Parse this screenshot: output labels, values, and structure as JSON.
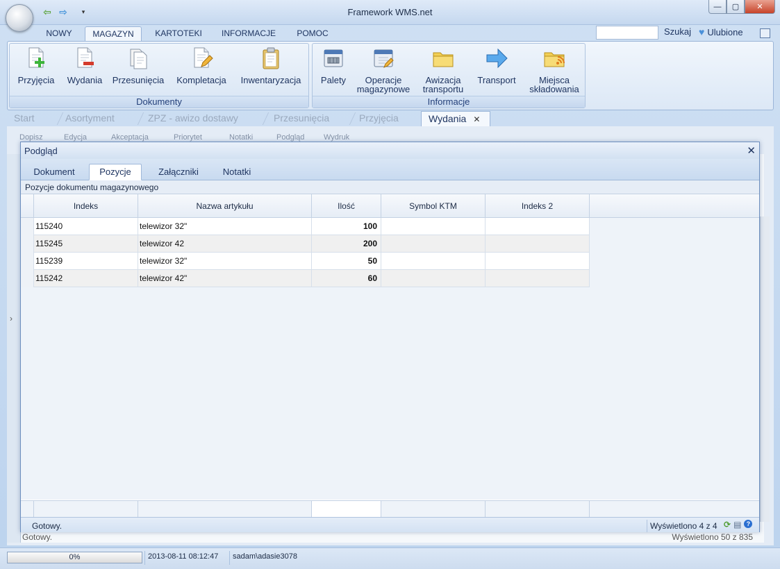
{
  "window": {
    "title": "Framework WMS.net"
  },
  "ribbon_tabs": [
    "NOWY",
    "MAGAZYN",
    "KARTOTEKI",
    "INFORMACJE",
    "POMOC"
  ],
  "search": {
    "label": "Szukaj",
    "value": ""
  },
  "favorites": {
    "label": "Ulubione"
  },
  "groups": {
    "dokumenty": {
      "label": "Dokumenty",
      "buttons": [
        "Przyjęcia",
        "Wydania",
        "Przesunięcia",
        "Kompletacja",
        "Inwentaryzacja"
      ]
    },
    "informacje": {
      "label": "Informacje",
      "buttons": [
        {
          "line1": "Palety",
          "line2": ""
        },
        {
          "line1": "Operacje",
          "line2": "magazynowe"
        },
        {
          "line1": "Awizacja",
          "line2": "transportu"
        },
        {
          "line1": "Transport",
          "line2": ""
        },
        {
          "line1": "Miejsca",
          "line2": "składowania"
        }
      ]
    }
  },
  "doc_tabs": [
    "Start",
    "Asortyment",
    "ZPZ - awizo dostawy",
    "Przesunięcia",
    "Przyjęcia",
    "Wydania"
  ],
  "doc_toolbar": [
    "Dopisz",
    "Edycja",
    "Akceptacja",
    "Priorytet",
    "Notatki",
    "Podgląd",
    "Wydruk"
  ],
  "background": {
    "status_left": "Gotowy.",
    "status_right": "Wyświetlono 50 z 835"
  },
  "dialog": {
    "title": "Podgląd",
    "tabs": [
      "Dokument",
      "Pozycje",
      "Załączniki",
      "Notatki"
    ],
    "grid_caption": "Pozycje dokumentu magazynowego",
    "columns": [
      "Indeks",
      "Nazwa artykułu",
      "Ilość",
      "Symbol KTM",
      "Indeks 2"
    ],
    "rows": [
      {
        "indeks": "115240",
        "nazwa": "telewizor 32\"",
        "ilosc": "100",
        "ktm": "",
        "indeks2": ""
      },
      {
        "indeks": "115245",
        "nazwa": "telewizor 42",
        "ilosc": "200",
        "ktm": "",
        "indeks2": ""
      },
      {
        "indeks": "115239",
        "nazwa": "telewizor 32\"",
        "ilosc": "50",
        "ktm": "",
        "indeks2": ""
      },
      {
        "indeks": "115242",
        "nazwa": "telewizor 42\"",
        "ilosc": "60",
        "ktm": "",
        "indeks2": ""
      }
    ],
    "status_left": "Gotowy.",
    "status_right": "Wyświetlono 4 z 4"
  },
  "app_status": {
    "progress_value": 0,
    "progress_label": "0%",
    "datetime": "2013-08-11 08:12:47",
    "user": "sadam\\adasie3078"
  }
}
